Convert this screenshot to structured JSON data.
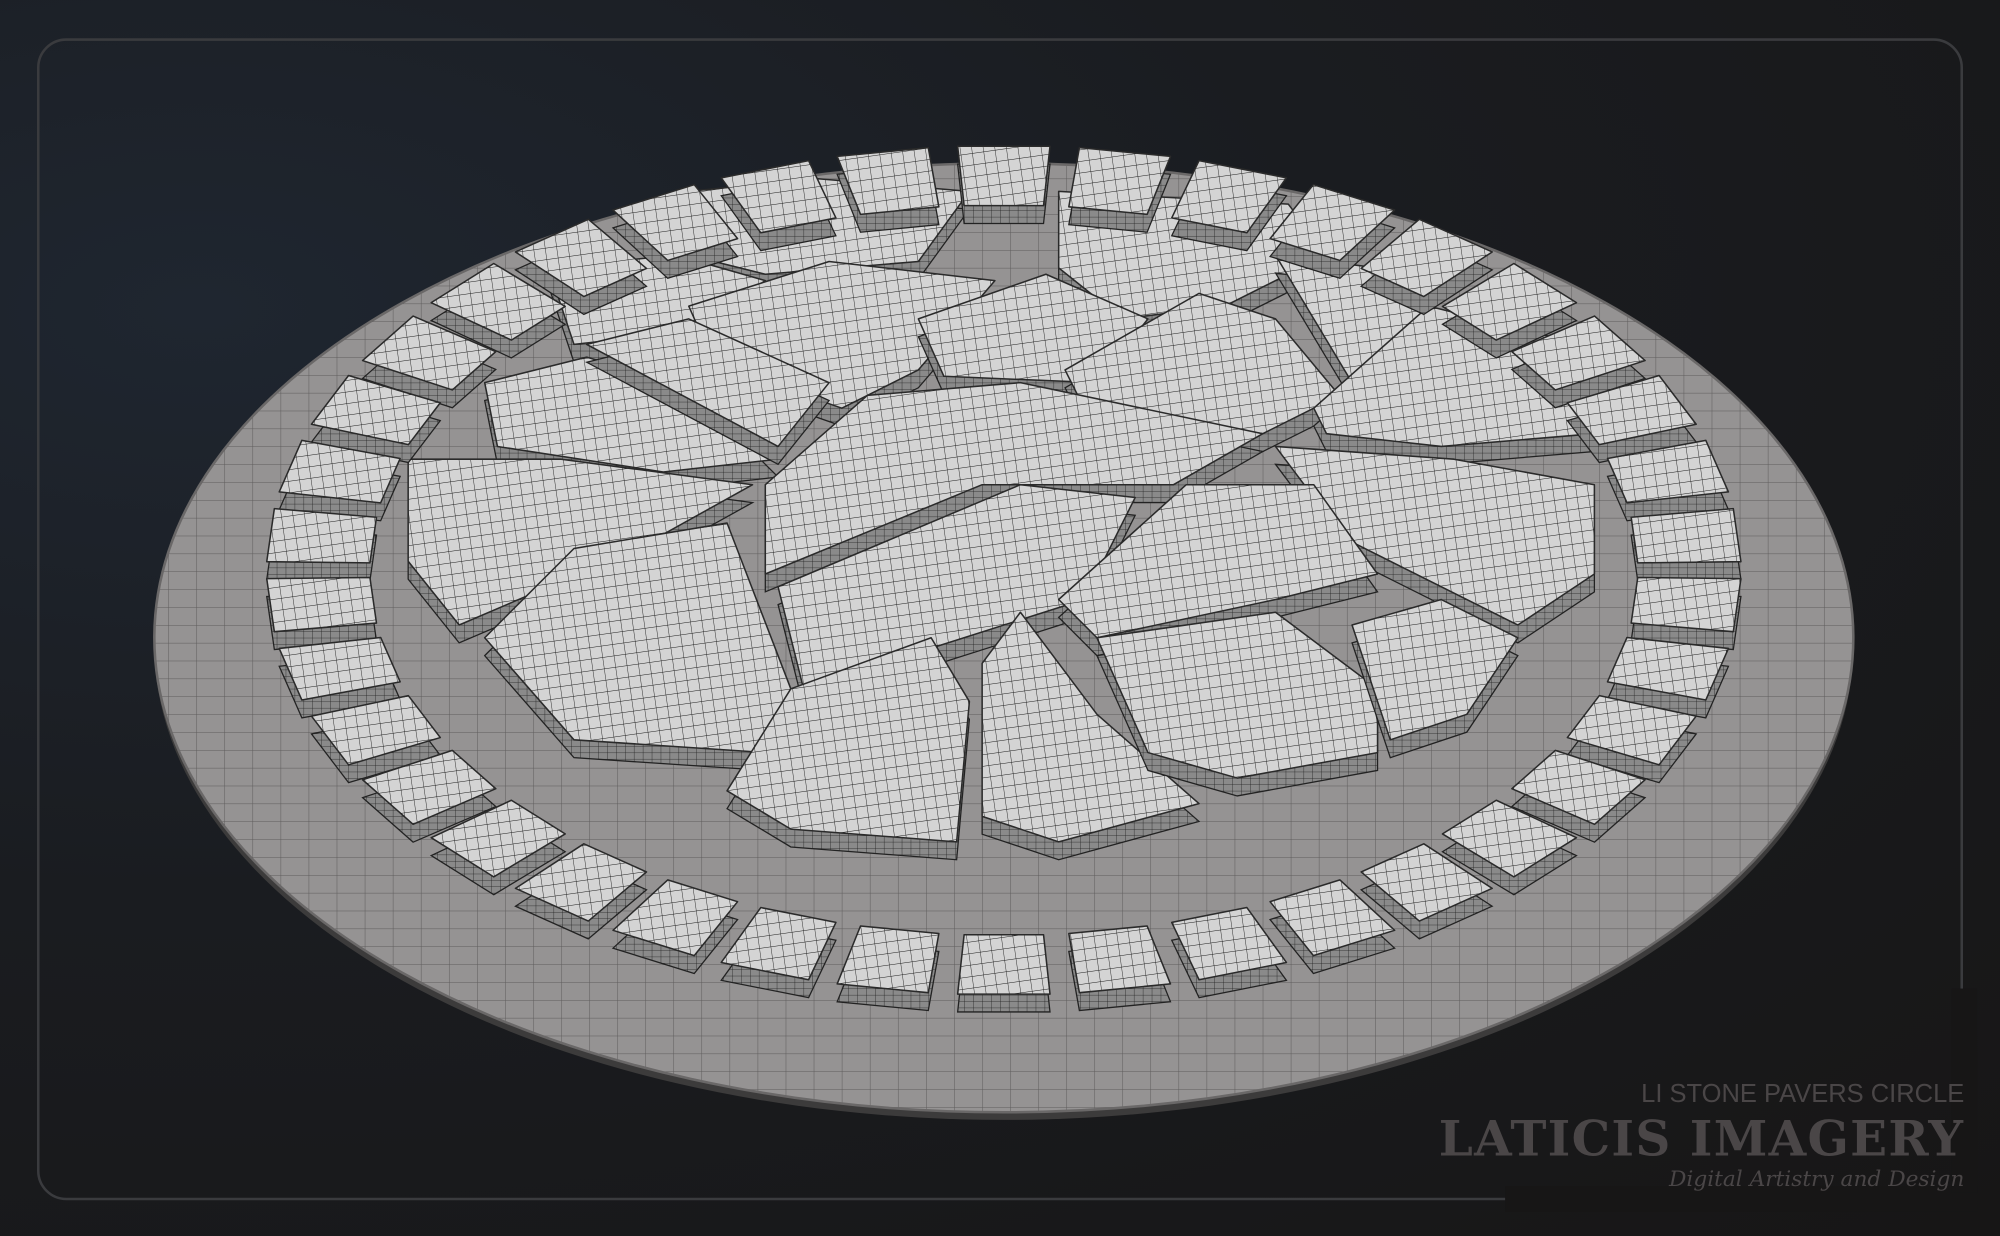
{
  "caption": {
    "product": "LI STONE PAVERS CIRCLE",
    "brand": "LATICIS IMAGERY",
    "tagline": "Digital Artistry and Design"
  },
  "colors": {
    "background": "#1a1b1e",
    "frame": "#3a3b3e",
    "base": "#8e8c8c",
    "stone": "#d2d2d2",
    "wire": "#1e1e1e",
    "text": "#4a4647"
  }
}
